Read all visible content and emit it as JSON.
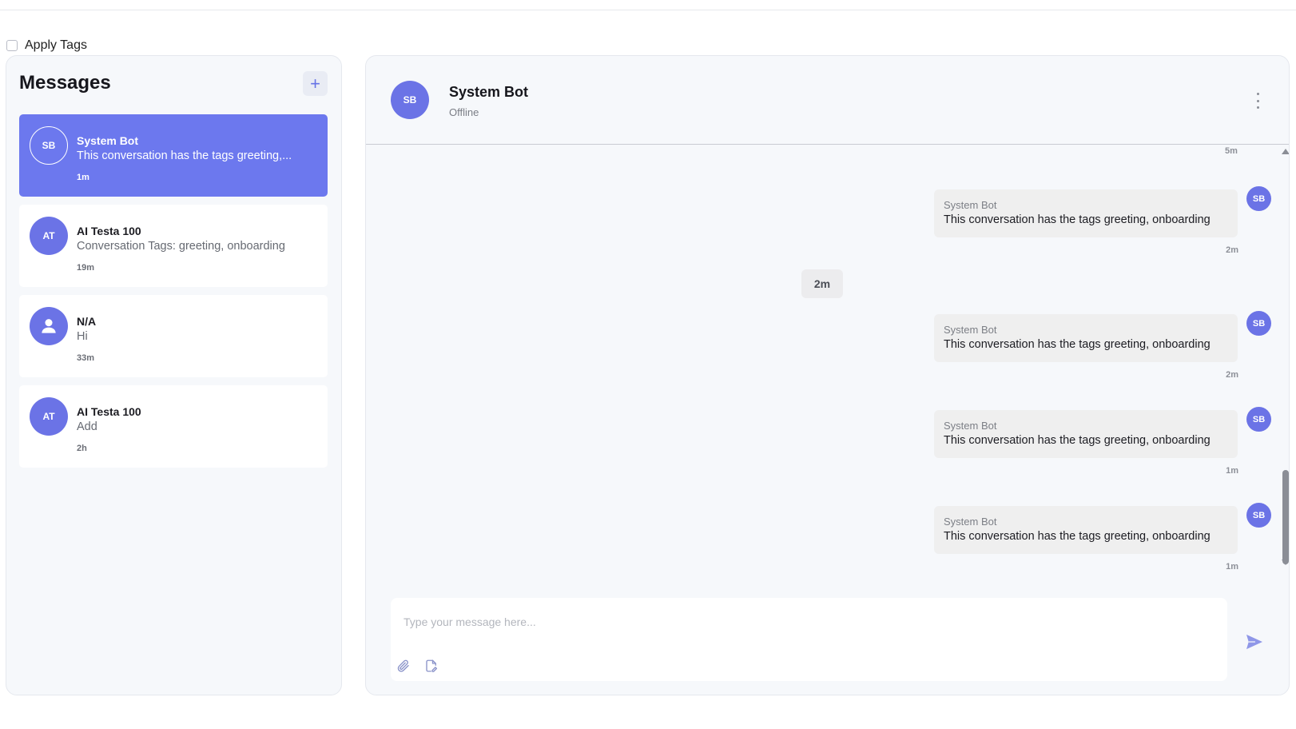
{
  "apply_tags": {
    "label": "Apply Tags",
    "checked": false
  },
  "sidebar": {
    "title": "Messages",
    "add_label": "+",
    "conversations": [
      {
        "initials": "SB",
        "name": "System Bot",
        "preview": "This conversation has the tags greeting,...",
        "time": "1m",
        "active": true
      },
      {
        "initials": "AT",
        "name": "AI Testa 100",
        "preview": "Conversation Tags: greeting, onboarding",
        "time": "19m",
        "active": false
      },
      {
        "initials": "",
        "name": "N/A",
        "preview": "Hi",
        "time": "33m",
        "active": false,
        "avatar_icon": "person-icon"
      },
      {
        "initials": "AT",
        "name": "AI Testa 100",
        "preview": "Add",
        "time": "2h",
        "active": false
      }
    ]
  },
  "chat": {
    "header": {
      "initials": "SB",
      "name": "System Bot",
      "status": "Offline"
    },
    "top_time": "5m",
    "divider": "2m",
    "messages": [
      {
        "sender": "System Bot",
        "text": "This conversation has the tags greeting, onboarding",
        "time": "2m",
        "initials": "SB"
      },
      {
        "sender": "System Bot",
        "text": "This conversation has the tags greeting, onboarding",
        "time": "2m",
        "initials": "SB"
      },
      {
        "sender": "System Bot",
        "text": "This conversation has the tags greeting, onboarding",
        "time": "1m",
        "initials": "SB"
      },
      {
        "sender": "System Bot",
        "text": "This conversation has the tags greeting, onboarding",
        "time": "1m",
        "initials": "SB"
      }
    ],
    "composer": {
      "placeholder": "Type your message here..."
    }
  },
  "colors": {
    "accent": "#6c78ee",
    "avatar": "#6b73e6",
    "panel": "#f6f8fb",
    "bubble": "#efefef"
  },
  "icons": {
    "attach": "paperclip-icon",
    "note": "note-edit-icon",
    "send": "send-icon",
    "more": "more-vertical-icon"
  }
}
